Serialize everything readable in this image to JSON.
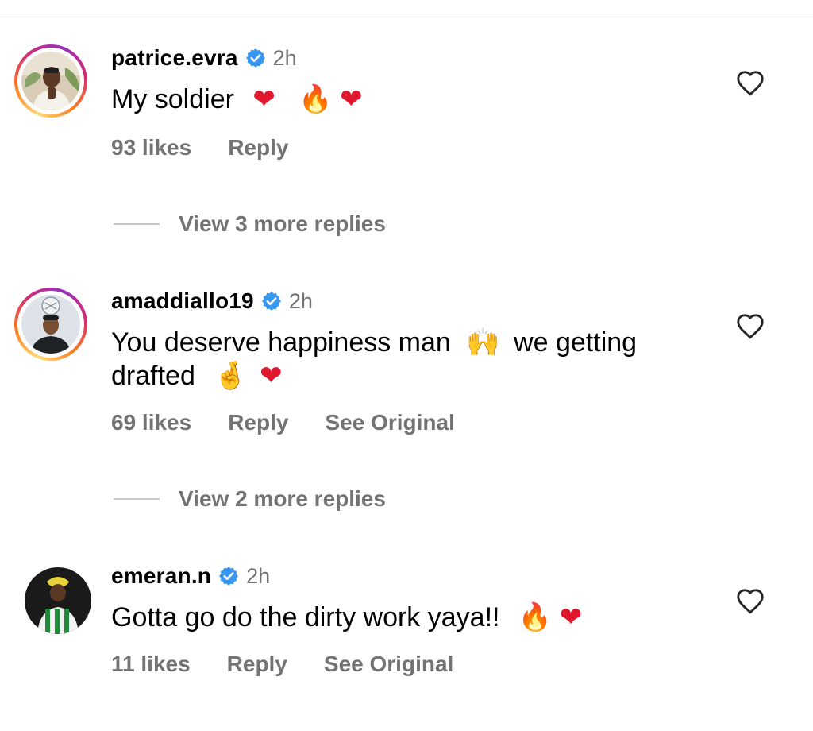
{
  "comments": [
    {
      "username": "patrice.evra",
      "verified": true,
      "time": "2h",
      "text": "My soldier",
      "emojis": [
        {
          "char": "❤",
          "name": "heart"
        },
        {
          "char": "🔥",
          "name": "fire"
        },
        {
          "char": "❤",
          "name": "heart"
        }
      ],
      "likes": "93 likes",
      "reply": "Reply",
      "view_replies": "View 3 more replies"
    },
    {
      "username": "amaddiallo19",
      "verified": true,
      "time": "2h",
      "text_line1": "You deserve happiness man",
      "text_line1_tail": "we getting",
      "text_line2": "drafted",
      "emoji_hands": "🙌",
      "emoji_fingers": "🤞",
      "emoji_heart": "❤",
      "likes": "69 likes",
      "reply": "Reply",
      "see_original": "See Original",
      "view_replies": "View 2 more replies"
    },
    {
      "username": "emeran.n",
      "verified": true,
      "time": "2h",
      "text": "Gotta go do the dirty work yaya!!",
      "emojis": [
        {
          "char": "🔥",
          "name": "fire"
        },
        {
          "char": "❤",
          "name": "heart"
        }
      ],
      "likes": "11 likes",
      "reply": "Reply",
      "see_original": "See Original"
    }
  ],
  "colors": {
    "verified": "#3897f0",
    "secondary_text": "#737373",
    "heart": "#e0182d"
  }
}
